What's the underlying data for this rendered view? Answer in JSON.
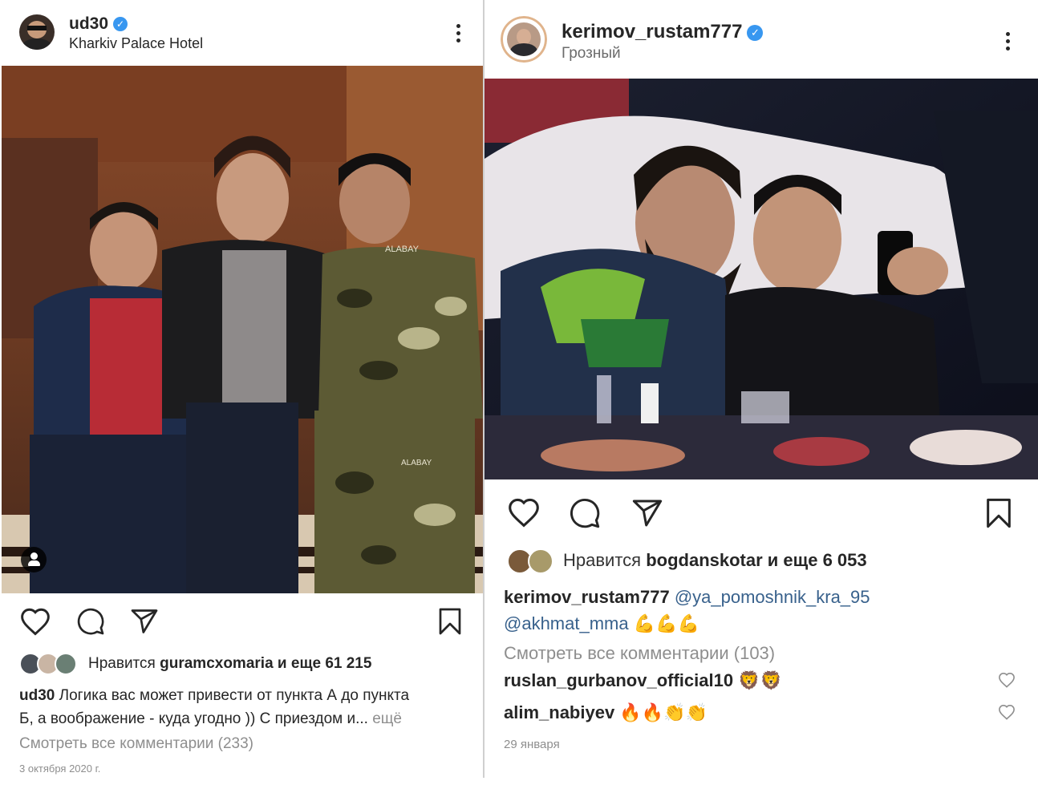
{
  "left_post": {
    "username": "ud30",
    "location": "Kharkiv Palace Hotel",
    "likes_prefix": "Нравится",
    "likes_user": "guramcxomaria",
    "likes_suffix": "и еще 61 215",
    "caption_user": "ud30",
    "caption_line1": "Логика вас может привести от пункта А до пункта",
    "caption_line2": "Б, а воображение - куда угодно )) С приездом и...",
    "more_label": "ещё",
    "view_all_comments": "Смотреть все комментарии (233)",
    "date": "3 октября 2020 г.",
    "photo_text_1": "ALABAY",
    "photo_text_2": "ALABAY"
  },
  "right_post": {
    "username": "kerimov_rustam777",
    "location": "Грозный",
    "likes_prefix": "Нравится",
    "likes_user": "bogdanskotar",
    "likes_suffix": "и еще 6 053",
    "caption_user": "kerimov_rustam777",
    "caption_mention1": "@ya_pomoshnik_kra_95",
    "caption_mention2": "@akhmat_mma",
    "caption_emoji": "💪💪💪",
    "view_all_comments": "Смотреть все комментарии (103)",
    "comments": [
      {
        "user": "ruslan_gurbanov_official10",
        "text": "🦁🦁"
      },
      {
        "user": "alim_nabiyev",
        "text": "🔥🔥👏👏"
      }
    ],
    "date": "29 января"
  },
  "icons": [
    "verified-badge-icon",
    "more-options-icon",
    "heart-icon",
    "comment-icon",
    "share-icon",
    "bookmark-icon",
    "user-tag-icon"
  ],
  "colors": {
    "verified": "#3897f0",
    "link": "#38618c",
    "muted": "#8e8e8e",
    "text": "#262626"
  }
}
